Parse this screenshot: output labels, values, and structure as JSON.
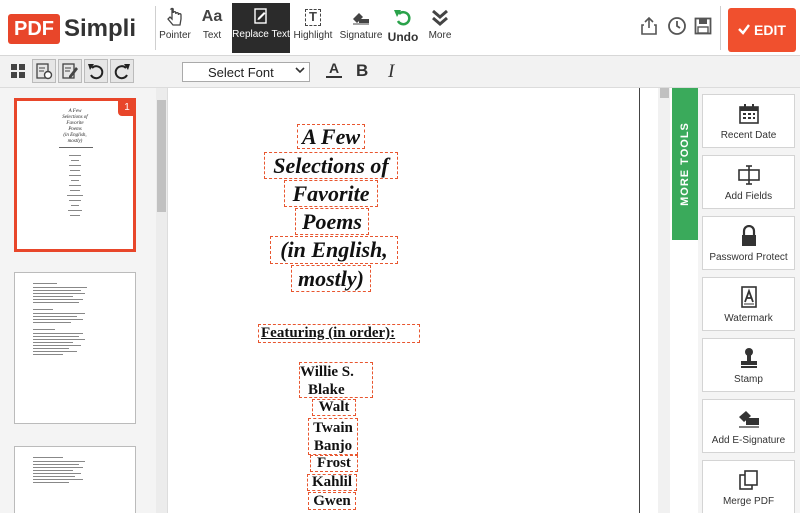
{
  "app": {
    "logo_pdf": "PDF",
    "logo_simpli": "Simpli"
  },
  "toolbar": {
    "tools": [
      {
        "label": "Pointer",
        "icon": "pointer-icon"
      },
      {
        "label": "Text",
        "icon": "text-aa-icon",
        "glyph": "Aa"
      },
      {
        "label": "Replace Text",
        "icon": "replace-text-icon",
        "active": true
      },
      {
        "label": "Highlight",
        "icon": "highlight-icon",
        "glyph": "T"
      },
      {
        "label": "Signature",
        "icon": "signature-icon"
      },
      {
        "label": "Undo",
        "icon": "undo-icon"
      },
      {
        "label": "More",
        "icon": "more-chevrons-icon"
      }
    ],
    "edit_label": "EDIT",
    "edit_color": "#f0502e"
  },
  "format_bar": {
    "font_select_value": "Select Font",
    "color_glyph": "A",
    "bold_glyph": "B",
    "italic_glyph": "I"
  },
  "thumbnails": {
    "first_badge": "1",
    "first_title_lines": [
      "A Few",
      "Selections of",
      "Favorite",
      "Poems",
      "(in English,",
      "mostly)"
    ]
  },
  "document": {
    "title_lines": [
      "A Few",
      "Selections of",
      "Favorite",
      "Poems",
      "(in English,",
      "mostly)"
    ],
    "featuring": "Featuring (in order):",
    "names": [
      "Willie S.",
      "Blake",
      "Walt",
      "Twain",
      "Banjo",
      "Frost",
      "Kahlil",
      "Gwen"
    ]
  },
  "right_panel": {
    "more_tools_label": "MORE TOOLS",
    "tab_color": "#3aaa5b",
    "tools": [
      {
        "label": "Recent Date",
        "icon": "calendar-icon"
      },
      {
        "label": "Add Fields",
        "icon": "add-fields-icon"
      },
      {
        "label": "Password Protect",
        "icon": "lock-icon"
      },
      {
        "label": "Watermark",
        "icon": "watermark-icon"
      },
      {
        "label": "Stamp",
        "icon": "stamp-icon"
      },
      {
        "label": "Add E-Signature",
        "icon": "e-signature-icon"
      },
      {
        "label": "Merge PDF",
        "icon": "merge-pdf-icon"
      }
    ]
  }
}
